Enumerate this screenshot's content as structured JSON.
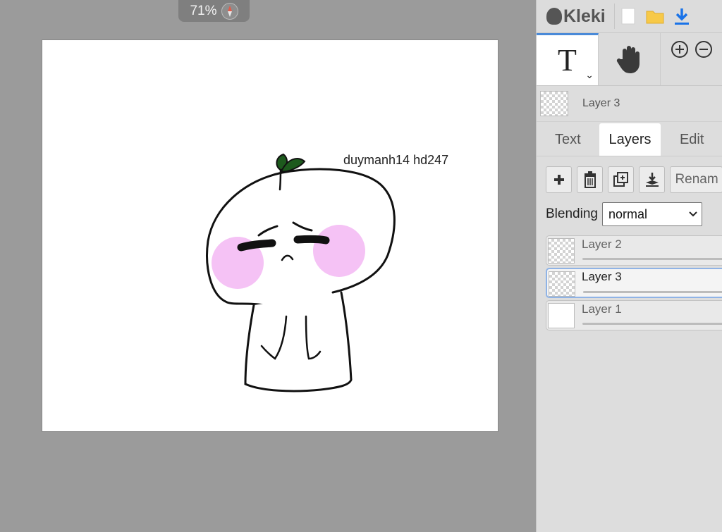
{
  "zoom": {
    "label": "71%"
  },
  "canvas": {
    "caption": "duymanh14 hd247"
  },
  "app": {
    "logo_text": "Kleki"
  },
  "current_layer": {
    "name": "Layer 3"
  },
  "tabs": [
    {
      "label": "Text"
    },
    {
      "label": "Layers"
    },
    {
      "label": "Edit"
    }
  ],
  "actions": {
    "rename_label": "Renam"
  },
  "blending": {
    "label": "Blending",
    "value": "normal"
  },
  "layers": [
    {
      "name": "Layer 2"
    },
    {
      "name": "Layer 3"
    },
    {
      "name": "Layer 1"
    }
  ],
  "colors": {
    "accent": "#4a8ad8",
    "cheek": "#f5c2f5",
    "leaf": "#1d5a1d"
  }
}
